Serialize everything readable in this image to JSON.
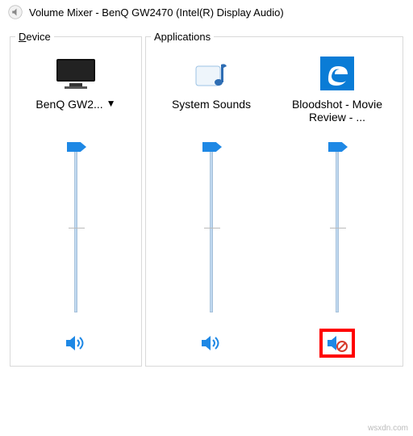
{
  "window": {
    "title": "Volume Mixer - BenQ GW2470 (Intel(R) Display Audio)"
  },
  "groups": {
    "device_label_prefix": "D",
    "device_label_rest": "evice",
    "apps_label": "Applications"
  },
  "device": {
    "name": "BenQ GW2...",
    "icon": "monitor-icon",
    "volume": 100,
    "muted": false
  },
  "applications": [
    {
      "name": "System Sounds",
      "icon": "system-sounds-icon",
      "volume": 100,
      "muted": false
    },
    {
      "name": "Bloodshot - Movie Review - ...",
      "icon": "edge-icon",
      "volume": 100,
      "muted": true
    }
  ],
  "watermark": "wsxdn.com"
}
